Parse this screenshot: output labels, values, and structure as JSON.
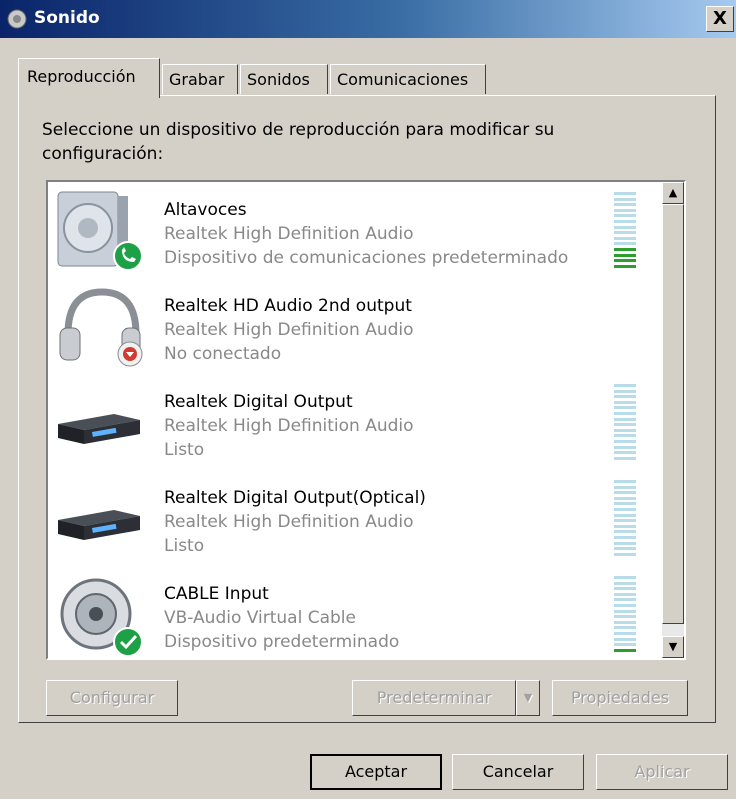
{
  "window": {
    "title": "Sonido",
    "close_label": "X"
  },
  "tabs": [
    {
      "label": "Reproducción",
      "active": true
    },
    {
      "label": "Grabar",
      "active": false
    },
    {
      "label": "Sonidos",
      "active": false
    },
    {
      "label": "Comunicaciones",
      "active": false
    }
  ],
  "instruction": "Seleccione un dispositivo de reproducción para modificar su configuración:",
  "devices": [
    {
      "name": "Altavoces",
      "driver": "Realtek High Definition Audio",
      "status": "Dispositivo de comunicaciones predeterminado",
      "icon": "speaker-icon",
      "badge": "phone-badge-icon",
      "meter_level": 0.25
    },
    {
      "name": "Realtek HD Audio 2nd output",
      "driver": "Realtek High Definition Audio",
      "status": "No conectado",
      "icon": "headphones-icon",
      "badge": "disconnected-badge-icon",
      "meter_level": null
    },
    {
      "name": "Realtek Digital Output",
      "driver": "Realtek High Definition Audio",
      "status": "Listo",
      "icon": "digital-output-icon",
      "badge": null,
      "meter_level": 0
    },
    {
      "name": "Realtek Digital Output(Optical)",
      "driver": "Realtek High Definition Audio",
      "status": "Listo",
      "icon": "digital-output-icon",
      "badge": null,
      "meter_level": 0
    },
    {
      "name": "CABLE Input",
      "driver": "VB-Audio Virtual Cable",
      "status": "Dispositivo predeterminado",
      "icon": "cable-input-icon",
      "badge": "default-check-badge-icon",
      "meter_level": 0.08
    }
  ],
  "buttons": {
    "configure": "Configurar",
    "set_default": "Predeterminar",
    "properties": "Propiedades",
    "ok": "Aceptar",
    "cancel": "Cancelar",
    "apply": "Aplicar"
  },
  "colors": {
    "titlebar_start": "#0a246a",
    "titlebar_end": "#a6caf0",
    "meter_active": "#2e9e2e",
    "meter_idle": "#b8dde8",
    "disabled_text": "#a0a0a0"
  }
}
